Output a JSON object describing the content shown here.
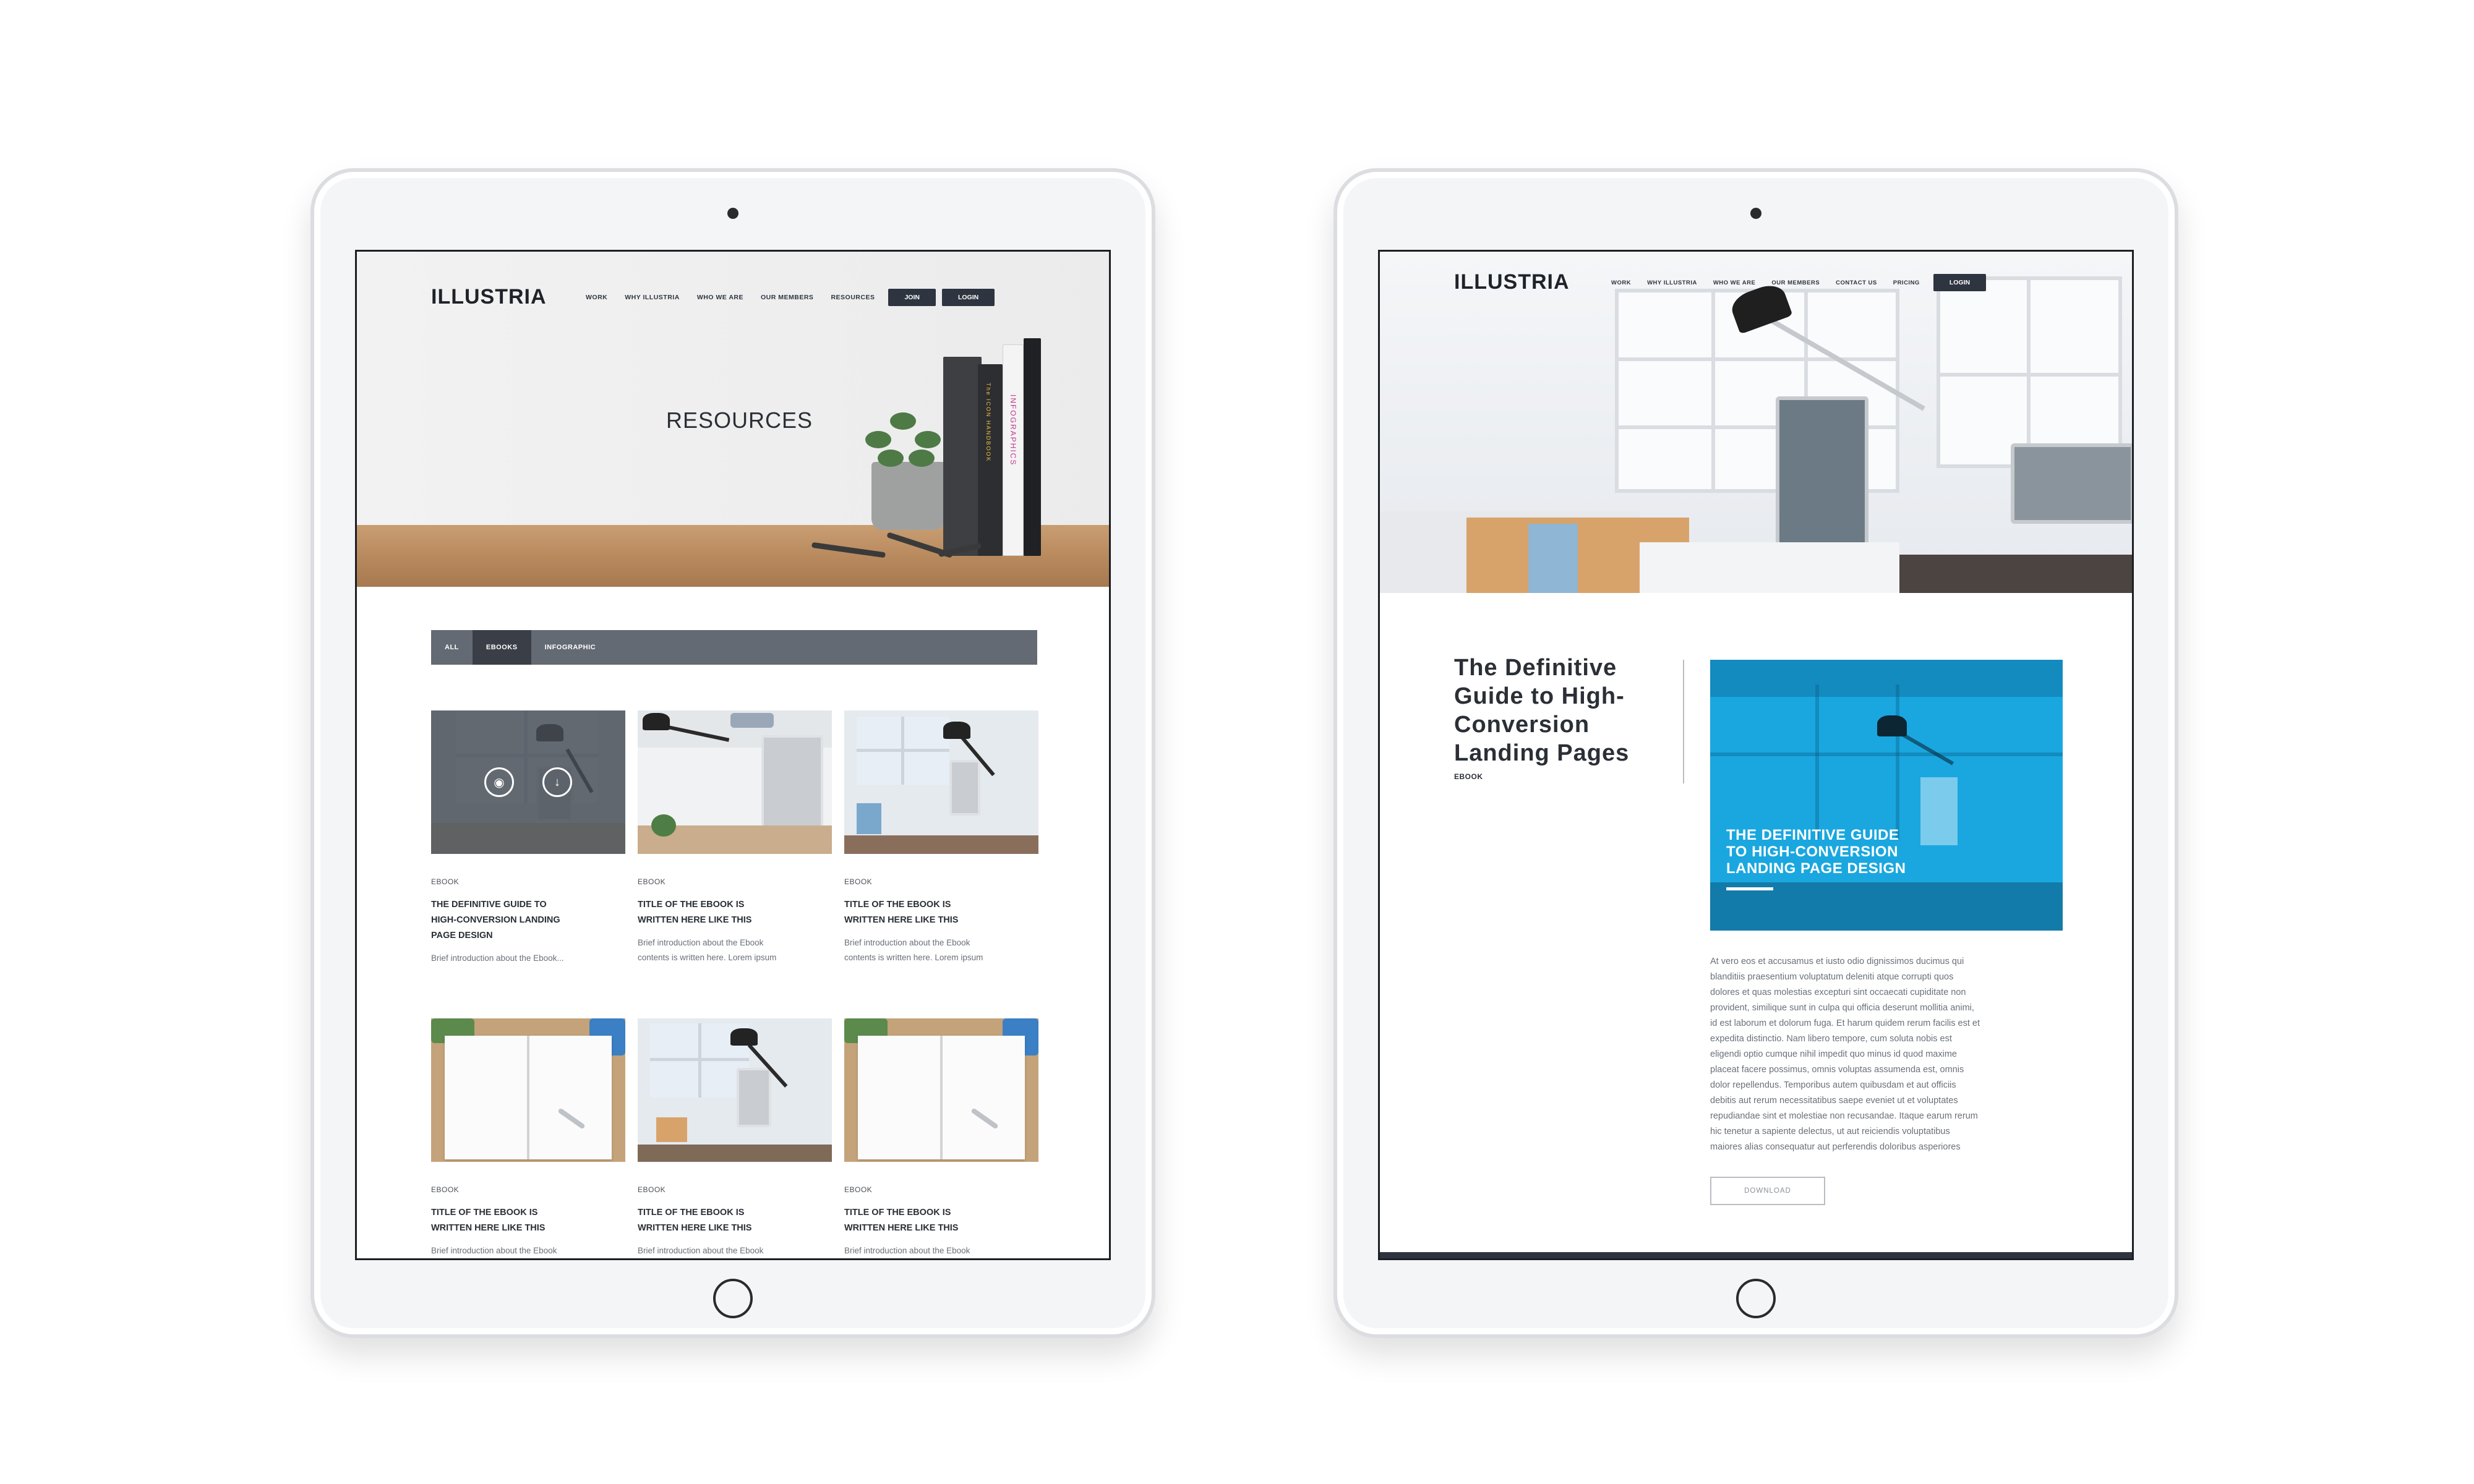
{
  "brand": "ILLUSTRIA",
  "left_page": {
    "nav": [
      "WORK",
      "WHY ILLUSTRIA",
      "WHO WE ARE",
      "OUR MEMBERS",
      "RESOURCES"
    ],
    "join_label": "JOIN",
    "login_label": "LOGIN",
    "hero_title": "RESOURCES",
    "hero_books": [
      "The ICON HANDBOOK",
      "INFOGRAPHICS"
    ],
    "filters": [
      "ALL",
      "EBOOKS",
      "INFOGRAPHIC"
    ],
    "active_filter": "EBOOKS",
    "cards": [
      {
        "category": "EBOOK",
        "title_lines": [
          "THE DEFINITIVE GUIDE TO",
          "HIGH-CONVERSION LANDING",
          "PAGE DESIGN"
        ],
        "desc_lines": [
          "Brief introduction about the Ebook..."
        ]
      },
      {
        "category": "EBOOK",
        "title_lines": [
          "TITLE OF THE EBOOK IS",
          "WRITTEN HERE LIKE THIS"
        ],
        "desc_lines": [
          "Brief introduction about the Ebook",
          "contents is written here. Lorem ipsum"
        ]
      },
      {
        "category": "EBOOK",
        "title_lines": [
          "TITLE OF THE EBOOK IS",
          "WRITTEN HERE LIKE THIS"
        ],
        "desc_lines": [
          "Brief introduction about the Ebook",
          "contents is written here. Lorem ipsum"
        ]
      },
      {
        "category": "EBOOK",
        "title_lines": [
          "TITLE OF THE EBOOK IS",
          "WRITTEN HERE LIKE THIS"
        ],
        "desc_lines": [
          "Brief introduction about the Ebook"
        ]
      },
      {
        "category": "EBOOK",
        "title_lines": [
          "TITLE OF THE EBOOK IS",
          "WRITTEN HERE LIKE THIS"
        ],
        "desc_lines": [
          "Brief introduction about the Ebook"
        ]
      },
      {
        "category": "EBOOK",
        "title_lines": [
          "TITLE OF THE EBOOK IS",
          "WRITTEN HERE LIKE THIS"
        ],
        "desc_lines": [
          "Brief introduction about the Ebook"
        ]
      }
    ],
    "overlay_icons": [
      "eye-icon",
      "download-icon"
    ]
  },
  "right_page": {
    "nav": [
      "WORK",
      "WHY ILLUSTRIA",
      "WHO WE ARE",
      "OUR MEMBERS",
      "CONTACT US",
      "PRICING"
    ],
    "login_label": "LOGIN",
    "article_title_lines": [
      "The Definitive",
      "Guide to High-",
      "Conversion",
      "Landing Pages"
    ],
    "article_category": "EBOOK",
    "cover_title_lines": [
      "THE DEFINITIVE GUIDE",
      "TO HIGH-CONVERSION",
      "LANDING PAGE DESIGN"
    ],
    "body_lines": [
      "At vero eos et accusamus et iusto odio dignissimos ducimus qui",
      "blanditiis praesentium voluptatum deleniti atque corrupti quos",
      "dolores et quas molestias excepturi sint occaecati cupiditate non",
      "provident, similique sunt in culpa qui officia deserunt mollitia animi,",
      "id est laborum et dolorum fuga. Et harum quidem rerum facilis est et",
      "expedita distinctio. Nam libero tempore, cum soluta nobis est",
      "eligendi optio cumque nihil impedit quo minus id quod maxime",
      "placeat facere possimus, omnis voluptas assumenda est, omnis",
      "dolor repellendus. Temporibus autem quibusdam et aut officiis",
      "debitis aut rerum necessitatibus saepe eveniet ut et voluptates",
      "repudiandae sint et molestiae non recusandae. Itaque earum rerum",
      "hic tenetur a sapiente delectus, ut aut reiciendis voluptatibus",
      "maiores alias consequatur aut perferendis doloribus asperiores"
    ],
    "download_label": "DOWNLOAD"
  },
  "colors": {
    "nav_button": "#2e3440",
    "filter_bar": "#646a73",
    "filter_active": "#3a3f47",
    "cover_blue": "#1aa7df"
  }
}
